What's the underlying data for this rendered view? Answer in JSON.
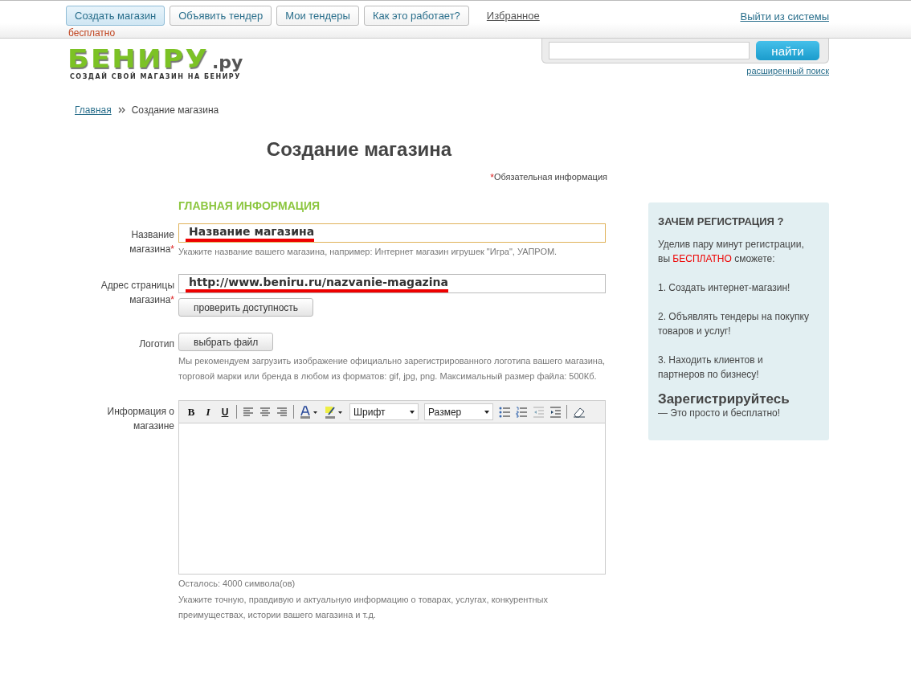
{
  "top_nav": {
    "buttons": [
      {
        "label": "Создать магазин",
        "selected": true
      },
      {
        "label": "Объявить тендер",
        "selected": false
      },
      {
        "label": "Мои тендеры",
        "selected": false
      },
      {
        "label": "Как это работает?",
        "selected": false
      }
    ],
    "favorites_link": "Избранное",
    "free_note": "бесплатно",
    "logout_link": "Выйти из системы"
  },
  "logo": {
    "name": "БЕНИРУ",
    "domain": ".ру",
    "tagline": "СОЗДАЙ СВОЙ МАГАЗИН НА БЕНИРУ"
  },
  "search": {
    "button": "найти",
    "advanced_link": "расширенный поиск"
  },
  "breadcrumbs": [
    {
      "label": "Главная",
      "link": true
    },
    {
      "label": "Создание магазина",
      "link": false
    }
  ],
  "page_title": "Создание магазина",
  "required_note": {
    "mark": "*",
    "text": "Обязательная информация"
  },
  "section_title": "ГЛАВНАЯ ИНФОРМАЦИЯ",
  "fields": [
    {
      "kind": "text",
      "label": "Название магазина",
      "required": true,
      "value": "Название магазина",
      "focused": true,
      "hint": "Укажите название вашего магазина, например: Интернет магазин игрушек \"Игра\", УАПРОМ."
    },
    {
      "kind": "text",
      "label": "Адрес страницы магазина",
      "required": true,
      "value": "http://www.beniru.ru/nazvanie-magazina",
      "focused": false,
      "button": "проверить доступность"
    },
    {
      "kind": "file",
      "label": "Логотип",
      "required": false,
      "button": "выбрать файл",
      "hint": "Мы рекомендуем загрузить изображение официально зарегистрированного логотипа вашего магазина, торговой марки или бренда в любом из форматов: gif, jpg, png. Максимальный размер файла: 500Кб."
    },
    {
      "kind": "editor",
      "label": "Информация о магазине",
      "required": false,
      "toolbar": {
        "bold": "B",
        "italic": "I",
        "underline": "U",
        "font": "Шрифт",
        "size": "Размер"
      },
      "counter": "Осталось: 4000 символа(ов)",
      "hint": "Укажите точную, правдивую и актуальную информацию о товарах, услугах, конкурентных преимуществах, истории вашего магазина и т.д."
    }
  ],
  "sidebar": {
    "title": "ЗАЧЕМ РЕГИСТРАЦИЯ ?",
    "intro": [
      {
        "text": "Уделив пару минут регистрации, вы ",
        "highlight": false
      },
      {
        "text": "БЕСПЛАТНО",
        "highlight": true
      },
      {
        "text": " сможете:",
        "highlight": false
      }
    ],
    "points": [
      "1. Создать интернет-магазин!",
      "2. Объявлять тендеры на покупку товаров и услуг!",
      "3. Находить клиентов и партнеров по бизнесу!"
    ],
    "cta_title": "Зарегистрируйтесь",
    "cta_text": "— Это просто и бесплатно!"
  }
}
